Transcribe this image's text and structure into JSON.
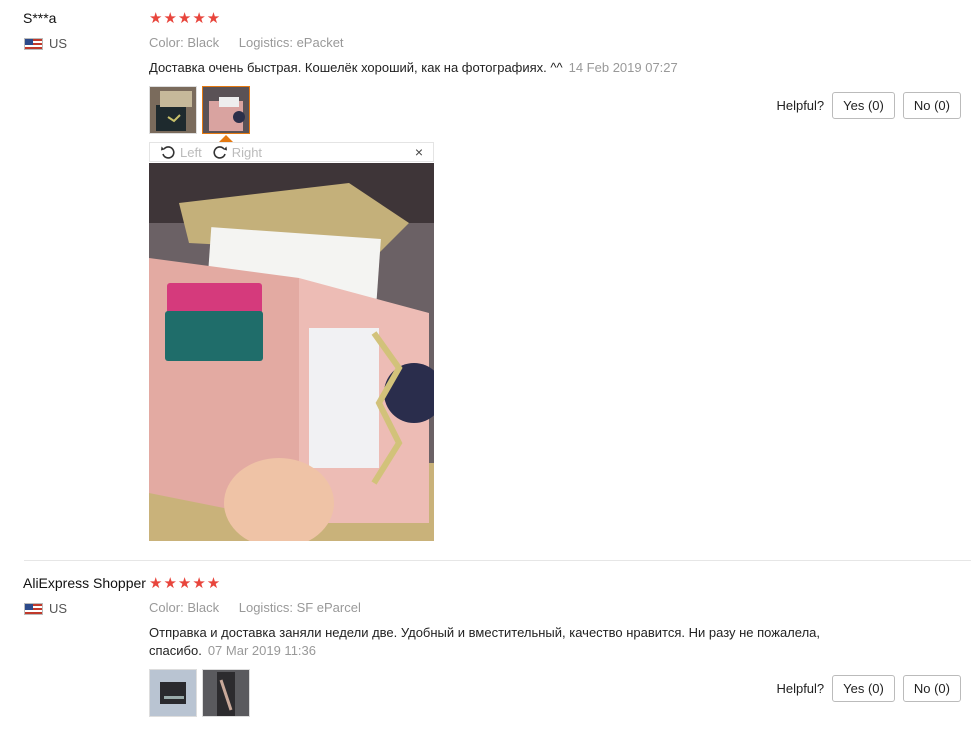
{
  "reviews": [
    {
      "user": "S***a",
      "country": "US",
      "color_key": "Color:",
      "color_val": "Black",
      "logistics_key": "Logistics:",
      "logistics_val": "ePacket",
      "text": "Доставка очень быстрая. Кошелёк хороший, как на фотографиях. ^^",
      "date": "14 Feb 2019 07:27",
      "helpful_label": "Helpful?",
      "yes_label": "Yes (0)",
      "no_label": "No (0)",
      "stars": 5
    },
    {
      "user": "AliExpress Shopper",
      "country": "US",
      "color_key": "Color:",
      "color_val": "Black",
      "logistics_key": "Logistics:",
      "logistics_val": "SF eParcel",
      "text": "Отправка и доставка заняли недели две. Удобный и вместительный, качество нравится. Ни разу не пожалела, спасибо.",
      "date": "07 Mar 2019 11:36",
      "helpful_label": "Helpful?",
      "yes_label": "Yes (0)",
      "no_label": "No (0)",
      "stars": 5
    }
  ],
  "viewer": {
    "rotate_left": "Left",
    "rotate_right": "Right",
    "close": "×"
  },
  "colors": {
    "star": "#e8453c",
    "active_thumb": "#e47911",
    "muted": "#999999"
  }
}
